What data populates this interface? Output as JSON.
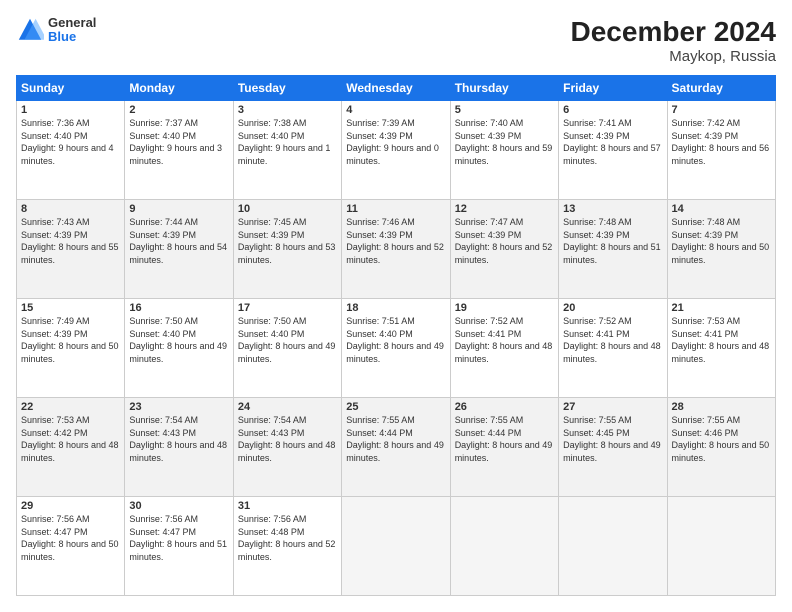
{
  "logo": {
    "general": "General",
    "blue": "Blue"
  },
  "title": "December 2024",
  "subtitle": "Maykop, Russia",
  "days": [
    "Sunday",
    "Monday",
    "Tuesday",
    "Wednesday",
    "Thursday",
    "Friday",
    "Saturday"
  ],
  "weeks": [
    [
      {
        "day": "1",
        "sunrise": "7:36 AM",
        "sunset": "4:40 PM",
        "daylight": "9 hours and 4 minutes."
      },
      {
        "day": "2",
        "sunrise": "7:37 AM",
        "sunset": "4:40 PM",
        "daylight": "9 hours and 3 minutes."
      },
      {
        "day": "3",
        "sunrise": "7:38 AM",
        "sunset": "4:40 PM",
        "daylight": "9 hours and 1 minute."
      },
      {
        "day": "4",
        "sunrise": "7:39 AM",
        "sunset": "4:39 PM",
        "daylight": "9 hours and 0 minutes."
      },
      {
        "day": "5",
        "sunrise": "7:40 AM",
        "sunset": "4:39 PM",
        "daylight": "8 hours and 59 minutes."
      },
      {
        "day": "6",
        "sunrise": "7:41 AM",
        "sunset": "4:39 PM",
        "daylight": "8 hours and 57 minutes."
      },
      {
        "day": "7",
        "sunrise": "7:42 AM",
        "sunset": "4:39 PM",
        "daylight": "8 hours and 56 minutes."
      }
    ],
    [
      {
        "day": "8",
        "sunrise": "7:43 AM",
        "sunset": "4:39 PM",
        "daylight": "8 hours and 55 minutes."
      },
      {
        "day": "9",
        "sunrise": "7:44 AM",
        "sunset": "4:39 PM",
        "daylight": "8 hours and 54 minutes."
      },
      {
        "day": "10",
        "sunrise": "7:45 AM",
        "sunset": "4:39 PM",
        "daylight": "8 hours and 53 minutes."
      },
      {
        "day": "11",
        "sunrise": "7:46 AM",
        "sunset": "4:39 PM",
        "daylight": "8 hours and 52 minutes."
      },
      {
        "day": "12",
        "sunrise": "7:47 AM",
        "sunset": "4:39 PM",
        "daylight": "8 hours and 52 minutes."
      },
      {
        "day": "13",
        "sunrise": "7:48 AM",
        "sunset": "4:39 PM",
        "daylight": "8 hours and 51 minutes."
      },
      {
        "day": "14",
        "sunrise": "7:48 AM",
        "sunset": "4:39 PM",
        "daylight": "8 hours and 50 minutes."
      }
    ],
    [
      {
        "day": "15",
        "sunrise": "7:49 AM",
        "sunset": "4:39 PM",
        "daylight": "8 hours and 50 minutes."
      },
      {
        "day": "16",
        "sunrise": "7:50 AM",
        "sunset": "4:40 PM",
        "daylight": "8 hours and 49 minutes."
      },
      {
        "day": "17",
        "sunrise": "7:50 AM",
        "sunset": "4:40 PM",
        "daylight": "8 hours and 49 minutes."
      },
      {
        "day": "18",
        "sunrise": "7:51 AM",
        "sunset": "4:40 PM",
        "daylight": "8 hours and 49 minutes."
      },
      {
        "day": "19",
        "sunrise": "7:52 AM",
        "sunset": "4:41 PM",
        "daylight": "8 hours and 48 minutes."
      },
      {
        "day": "20",
        "sunrise": "7:52 AM",
        "sunset": "4:41 PM",
        "daylight": "8 hours and 48 minutes."
      },
      {
        "day": "21",
        "sunrise": "7:53 AM",
        "sunset": "4:41 PM",
        "daylight": "8 hours and 48 minutes."
      }
    ],
    [
      {
        "day": "22",
        "sunrise": "7:53 AM",
        "sunset": "4:42 PM",
        "daylight": "8 hours and 48 minutes."
      },
      {
        "day": "23",
        "sunrise": "7:54 AM",
        "sunset": "4:43 PM",
        "daylight": "8 hours and 48 minutes."
      },
      {
        "day": "24",
        "sunrise": "7:54 AM",
        "sunset": "4:43 PM",
        "daylight": "8 hours and 48 minutes."
      },
      {
        "day": "25",
        "sunrise": "7:55 AM",
        "sunset": "4:44 PM",
        "daylight": "8 hours and 49 minutes."
      },
      {
        "day": "26",
        "sunrise": "7:55 AM",
        "sunset": "4:44 PM",
        "daylight": "8 hours and 49 minutes."
      },
      {
        "day": "27",
        "sunrise": "7:55 AM",
        "sunset": "4:45 PM",
        "daylight": "8 hours and 49 minutes."
      },
      {
        "day": "28",
        "sunrise": "7:55 AM",
        "sunset": "4:46 PM",
        "daylight": "8 hours and 50 minutes."
      }
    ],
    [
      {
        "day": "29",
        "sunrise": "7:56 AM",
        "sunset": "4:47 PM",
        "daylight": "8 hours and 50 minutes."
      },
      {
        "day": "30",
        "sunrise": "7:56 AM",
        "sunset": "4:47 PM",
        "daylight": "8 hours and 51 minutes."
      },
      {
        "day": "31",
        "sunrise": "7:56 AM",
        "sunset": "4:48 PM",
        "daylight": "8 hours and 52 minutes."
      },
      null,
      null,
      null,
      null
    ]
  ]
}
